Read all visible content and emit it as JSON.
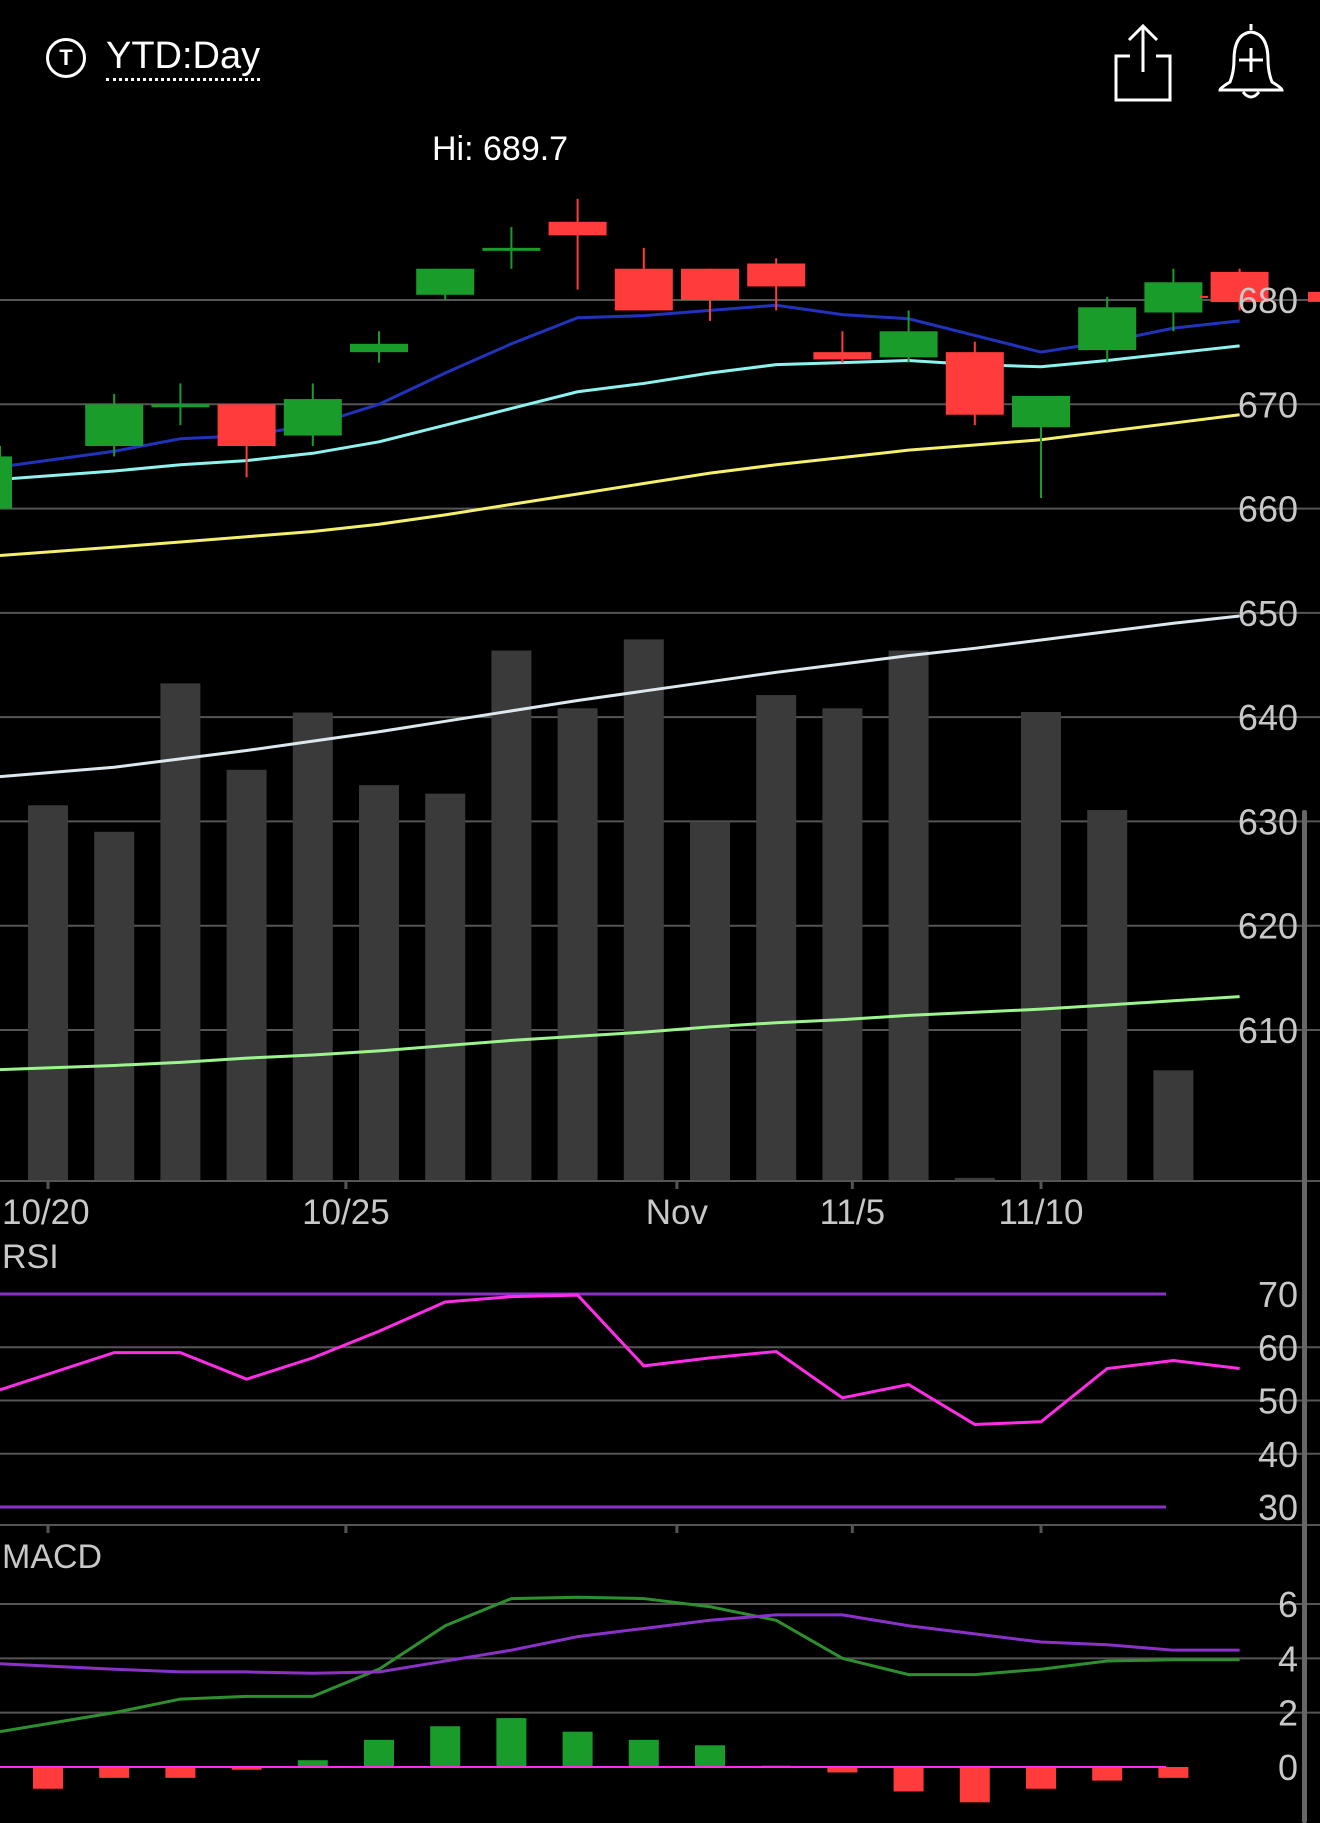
{
  "header": {
    "ticker_icon": "T",
    "timeframe": "YTD:Day",
    "share_icon": "share-icon",
    "alert_icon": "bell-plus-icon"
  },
  "colors": {
    "up": "#1a9c2a",
    "down": "#ff3b3b",
    "volume": "#3a3a3a",
    "ma_blue": "#2233bb",
    "ma_cyan": "#8ef2ee",
    "ma_yellow": "#f5ef6e",
    "ma_white": "#dde8ee",
    "ma_green": "#9cf58c",
    "rsi_line": "#ff2ee6",
    "rsi_bounds": "#8a32c8",
    "macd_line": "#2e8f2e",
    "signal_line": "#8a32c8",
    "grid": "#555555"
  },
  "chart_data": [
    {
      "type": "candlestick",
      "title": "",
      "high_label": "Hi: 689.7",
      "yticks": [
        680,
        670,
        660,
        650,
        640,
        630,
        620,
        610
      ],
      "ylim": [
        598,
        692
      ],
      "last_price_marker": 680.3,
      "xlabels": [
        {
          "label": "10/20",
          "index": 0
        },
        {
          "label": "10/25",
          "index": 4.5
        },
        {
          "label": "Nov",
          "index": 9.5
        },
        {
          "label": "11/5",
          "index": 12.15
        },
        {
          "label": "11/10",
          "index": 15
        }
      ],
      "candles": [
        {
          "open": 660,
          "close": 665,
          "high": 666,
          "low": 660
        },
        {
          "open": 666,
          "close": 670,
          "high": 671,
          "low": 665
        },
        {
          "open": 670,
          "close": 670,
          "high": 672,
          "low": 668
        },
        {
          "open": 670,
          "close": 666,
          "high": 670,
          "low": 663
        },
        {
          "open": 667,
          "close": 670.5,
          "high": 672,
          "low": 666
        },
        {
          "open": 675,
          "close": 675.8,
          "high": 677,
          "low": 674
        },
        {
          "open": 680.5,
          "close": 683,
          "high": 683,
          "low": 680
        },
        {
          "open": 685,
          "close": 685,
          "high": 687,
          "low": 683
        },
        {
          "open": 687.5,
          "close": 686.2,
          "high": 689.7,
          "low": 681
        },
        {
          "open": 683,
          "close": 679,
          "high": 685,
          "low": 679
        },
        {
          "open": 683,
          "close": 680,
          "high": 683,
          "low": 678
        },
        {
          "open": 683.5,
          "close": 681.3,
          "high": 684,
          "low": 679
        },
        {
          "open": 675,
          "close": 674.3,
          "high": 677,
          "low": 674
        },
        {
          "open": 674.5,
          "close": 677,
          "high": 679,
          "low": 674
        },
        {
          "open": 675,
          "close": 669,
          "high": 676,
          "low": 668
        },
        {
          "open": 667.8,
          "close": 670.8,
          "high": 670.8,
          "low": 661
        },
        {
          "open": 675.2,
          "close": 679.3,
          "high": 680.3,
          "low": 674
        },
        {
          "open": 678.8,
          "close": 681.7,
          "high": 683,
          "low": 677
        },
        {
          "open": 682.7,
          "close": 679.8,
          "high": 683,
          "low": 679
        }
      ],
      "moving_averages": [
        {
          "color_key": "ma_blue",
          "values": [
            664,
            665.5,
            666.7,
            667,
            668,
            670,
            673,
            675.8,
            678.3,
            678.5,
            679,
            679.5,
            678.6,
            678.2,
            676.6,
            675,
            676,
            677.3,
            678
          ]
        },
        {
          "color_key": "ma_cyan",
          "values": [
            662.8,
            663.6,
            664.2,
            664.6,
            665.3,
            666.4,
            668,
            669.6,
            671.2,
            672,
            673,
            673.8,
            674,
            674.2,
            673.8,
            673.6,
            674.2,
            674.9,
            675.6
          ]
        },
        {
          "color_key": "ma_yellow",
          "values": [
            655.5,
            656.3,
            656.8,
            657.3,
            657.8,
            658.5,
            659.4,
            660.4,
            661.4,
            662.4,
            663.4,
            664.2,
            664.9,
            665.6,
            666.1,
            666.6,
            667.4,
            668.2,
            669
          ]
        },
        {
          "color_key": "ma_white",
          "values": [
            634.3,
            635.2,
            636,
            636.8,
            637.7,
            638.6,
            639.6,
            640.6,
            641.6,
            642.5,
            643.4,
            644.3,
            645.1,
            645.9,
            646.6,
            647.4,
            648.2,
            649,
            649.7
          ]
        },
        {
          "color_key": "ma_green",
          "values": [
            606.2,
            606.6,
            606.9,
            607.3,
            607.6,
            608,
            608.5,
            609,
            609.4,
            609.8,
            610.3,
            610.7,
            611,
            611.4,
            611.7,
            612,
            612.4,
            612.8,
            613.2
          ]
        }
      ]
    },
    {
      "type": "bar",
      "title": "",
      "note": "volume bars, relative height (0-1) of the volume panel; no volume scale printed",
      "values": [
        0.707,
        0.657,
        0.937,
        0.774,
        0.882,
        0.745,
        0.729,
        0.999,
        0.89,
        1.02,
        0.676,
        0.915,
        0.89,
        0.999,
        0.004,
        0.883,
        0.698,
        0.207
      ]
    },
    {
      "type": "line",
      "title": "RSI",
      "yticks": [
        70,
        60,
        50,
        40,
        30
      ],
      "ylim": [
        28,
        73
      ],
      "overbought": 70,
      "oversold": 30,
      "values": [
        52,
        59,
        59,
        54,
        58,
        63,
        68.5,
        69.5,
        69.8,
        56.5,
        58,
        59.2,
        50.5,
        53,
        45.5,
        46,
        56,
        57.5,
        56
      ]
    },
    {
      "type": "line",
      "title": "MACD",
      "yticks": [
        6,
        4,
        2,
        0
      ],
      "ylim": [
        -1.5,
        7
      ],
      "macd": [
        1.3,
        2,
        2.5,
        2.6,
        2.6,
        3.6,
        5.2,
        6.2,
        6.25,
        6.2,
        5.9,
        5.4,
        4,
        3.4,
        3.4,
        3.6,
        3.9,
        3.95,
        3.95
      ],
      "signal": [
        3.8,
        3.6,
        3.5,
        3.5,
        3.45,
        3.5,
        3.9,
        4.3,
        4.8,
        5.1,
        5.4,
        5.6,
        5.6,
        5.2,
        4.9,
        4.6,
        4.5,
        4.3,
        4.3
      ],
      "histogram": [
        -0.8,
        -0.4,
        -0.4,
        -0.1,
        0.25,
        1,
        1.5,
        1.8,
        1.3,
        1,
        0.8,
        0.05,
        -0.2,
        -0.9,
        -1.3,
        -0.8,
        -0.5,
        -0.4
      ]
    }
  ]
}
